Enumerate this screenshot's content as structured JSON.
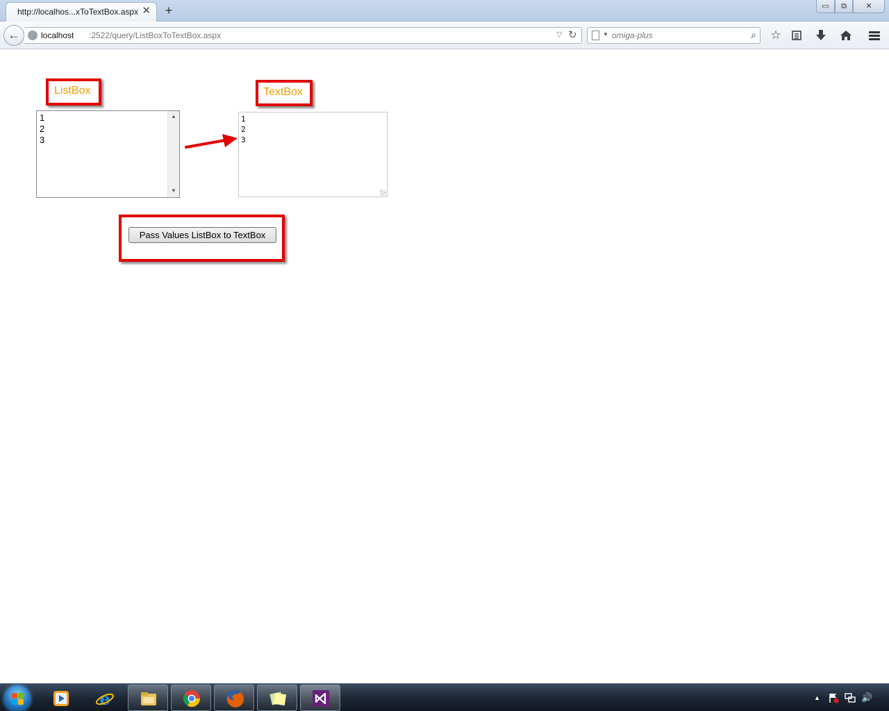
{
  "browser": {
    "tab_title": "http://localhos...xToTextBox.aspx",
    "tab_close": "✕",
    "new_tab": "+",
    "url_host": "localhost",
    "url_path": ":2522/query/ListBoxToTextBox.aspx",
    "search_placeholder": "omiga-plus",
    "window_controls": {
      "minimize": "▭",
      "maximize": "⧉",
      "close": "✕"
    }
  },
  "page": {
    "listbox_label": "ListBox",
    "textbox_label": "TextBox",
    "listbox_items": [
      "1",
      "2",
      "3"
    ],
    "textbox_lines": [
      "1",
      "2",
      "3"
    ],
    "pass_button_label": "Pass  Values ListBox to TextBox",
    "colors": {
      "callout_border": "#e20000",
      "label_text": "#f0a000",
      "arrow": "#e20000"
    }
  },
  "taskbar": {
    "items": [
      {
        "name": "media-player",
        "icon": "media-player-icon",
        "running": false
      },
      {
        "name": "internet-explorer",
        "icon": "internet-explorer-icon",
        "running": false
      },
      {
        "name": "file-explorer",
        "icon": "folder-icon",
        "running": true
      },
      {
        "name": "chrome",
        "icon": "chrome-icon",
        "running": true
      },
      {
        "name": "firefox",
        "icon": "firefox-icon",
        "running": true
      },
      {
        "name": "sticky-notes",
        "icon": "sticky-notes-icon",
        "running": true
      },
      {
        "name": "visual-studio",
        "icon": "visual-studio-icon",
        "running": true
      }
    ],
    "tray": {
      "show_hidden": "▲",
      "volume": "🔊"
    }
  }
}
